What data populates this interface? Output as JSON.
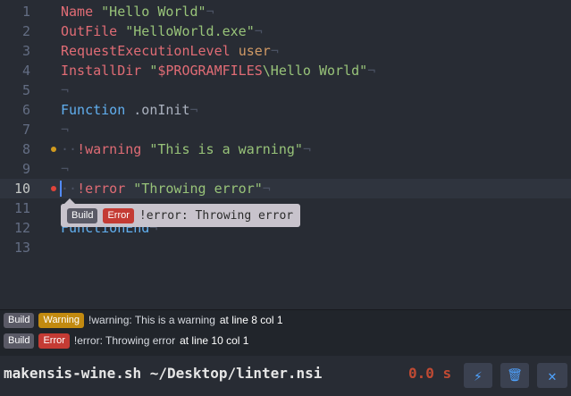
{
  "editor": {
    "lines": [
      {
        "num": "1"
      },
      {
        "num": "2"
      },
      {
        "num": "3"
      },
      {
        "num": "4"
      },
      {
        "num": "5"
      },
      {
        "num": "6"
      },
      {
        "num": "7"
      },
      {
        "num": "8"
      },
      {
        "num": "9"
      },
      {
        "num": "10"
      },
      {
        "num": "11"
      },
      {
        "num": "12"
      },
      {
        "num": "13"
      }
    ],
    "code": {
      "l1_kw": "Name",
      "l1_str": "\"Hello World\"",
      "l2_kw": "OutFile",
      "l2_str": "\"HelloWorld.exe\"",
      "l3_kw": "RequestExecutionLevel",
      "l3_val": "user",
      "l4_kw": "InstallDir",
      "l4_q1": "\"",
      "l4_var": "$PROGRAMFILES",
      "l4_rest": "\\Hello World\"",
      "l6_kw": "Function",
      "l6_name": ".onInit",
      "l8_lead": "··",
      "l8_kw": "!warning",
      "l8_str": "\"This is a warning\"",
      "l10_lead": "··",
      "l10_kw": "!error",
      "l10_str": "\"Throwing error\"",
      "l12_kw": "FunctionEnd",
      "eol": "¬"
    },
    "current_line": "10"
  },
  "tooltip": {
    "badge_build": "Build",
    "badge_error": "Error",
    "text": "!error: Throwing error"
  },
  "panel": {
    "messages": [
      {
        "source": "Build",
        "severity": "Warning",
        "text": "!warning: This is a warning",
        "location": "at line 8 col 1"
      },
      {
        "source": "Build",
        "severity": "Error",
        "text": "!error: Throwing error",
        "location": "at line 10 col 1"
      }
    ]
  },
  "statusbar": {
    "command": "makensis-wine.sh ~/Desktop/linter.nsi",
    "timer": "0.0 s",
    "buttons": [
      {
        "icon": "lightning-icon",
        "glyph": "⚡"
      },
      {
        "icon": "trash-icon",
        "glyph": "🗑"
      },
      {
        "icon": "close-icon",
        "glyph": "✕"
      }
    ]
  },
  "colors": {
    "accent": "#61afef",
    "error": "#c43b34",
    "warning": "#c28a10",
    "keyword": "#e06c75",
    "string": "#98c379"
  }
}
